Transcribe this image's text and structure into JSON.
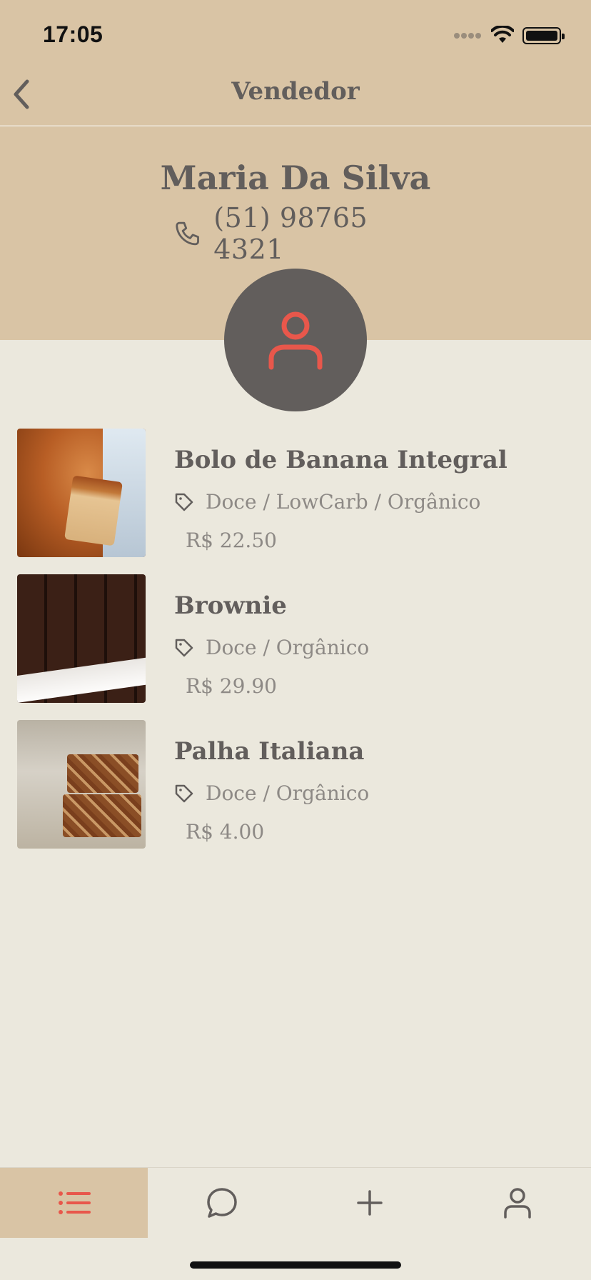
{
  "status_bar": {
    "time": "17:05"
  },
  "nav": {
    "title": "Vendedor",
    "back_icon": "chevron-left-icon"
  },
  "seller": {
    "name": "Maria Da Silva",
    "phone": "(51) 98765 4321",
    "phone_icon": "phone-icon",
    "avatar_icon": "user-icon"
  },
  "products": [
    {
      "name": "Bolo de Banana Integral",
      "tags": "Doce / LowCarb / Orgânico",
      "price": "R$ 22.50",
      "image": "banana-cake-photo"
    },
    {
      "name": "Brownie",
      "tags": "Doce / Orgânico",
      "price": "R$ 29.90",
      "image": "brownie-photo"
    },
    {
      "name": "Palha Italiana",
      "tags": "Doce / Orgânico",
      "price": "R$ 4.00",
      "image": "palha-italiana-photo"
    }
  ],
  "tabbar": {
    "items": [
      {
        "icon": "list-icon",
        "active": true
      },
      {
        "icon": "chat-bubble-icon",
        "active": false
      },
      {
        "icon": "plus-icon",
        "active": false
      },
      {
        "icon": "user-icon",
        "active": false
      }
    ]
  },
  "colors": {
    "header_bg": "#d9c4a5",
    "page_bg": "#ebe8dd",
    "text_primary": "#625e5c",
    "text_secondary": "#8d8985",
    "accent": "#e8574b",
    "avatar_bg": "#625e5c"
  }
}
